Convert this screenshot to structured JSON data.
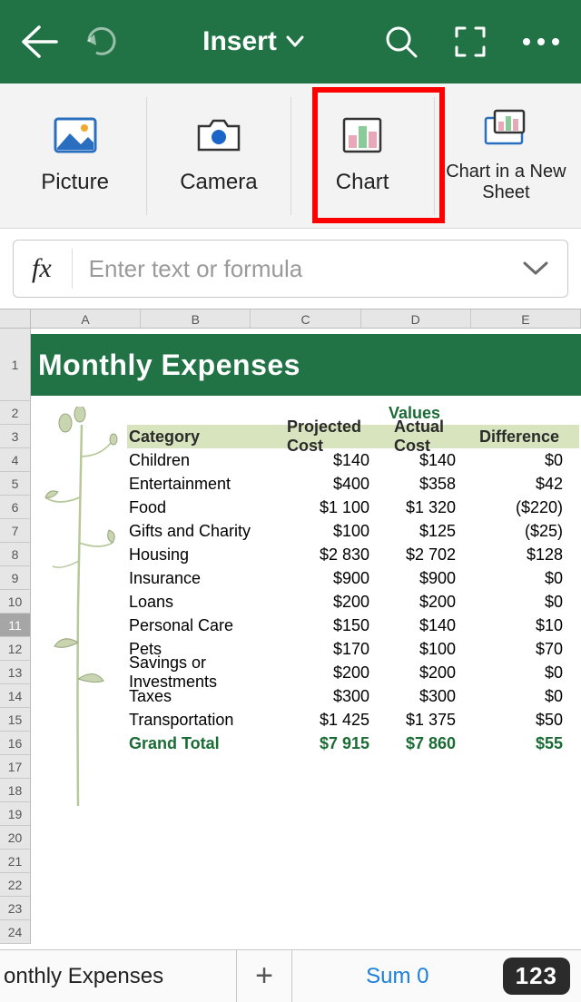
{
  "header": {
    "title": "Insert"
  },
  "ribbon": {
    "items": [
      {
        "label": "Picture"
      },
      {
        "label": "Camera"
      },
      {
        "label": "Chart"
      },
      {
        "label": "Chart in a New Sheet"
      }
    ]
  },
  "formula_bar": {
    "fx": "fx",
    "placeholder": "Enter text or formula"
  },
  "columns": [
    "A",
    "B",
    "C",
    "D",
    "E"
  ],
  "sheet_title": "Monthly Expenses",
  "selected_row_header": 11,
  "table": {
    "values_header": "Values",
    "header": {
      "category": "Category",
      "projected": "Projected Cost",
      "actual": "Actual Cost",
      "difference": "Difference"
    },
    "rows": [
      {
        "category": "Children",
        "projected": "$140",
        "actual": "$140",
        "difference": "$0"
      },
      {
        "category": "Entertainment",
        "projected": "$400",
        "actual": "$358",
        "difference": "$42"
      },
      {
        "category": "Food",
        "projected": "$1 100",
        "actual": "$1 320",
        "difference": "($220)"
      },
      {
        "category": "Gifts and Charity",
        "projected": "$100",
        "actual": "$125",
        "difference": "($25)"
      },
      {
        "category": "Housing",
        "projected": "$2 830",
        "actual": "$2 702",
        "difference": "$128"
      },
      {
        "category": "Insurance",
        "projected": "$900",
        "actual": "$900",
        "difference": "$0"
      },
      {
        "category": "Loans",
        "projected": "$200",
        "actual": "$200",
        "difference": "$0"
      },
      {
        "category": "Personal Care",
        "projected": "$150",
        "actual": "$140",
        "difference": "$10"
      },
      {
        "category": "Pets",
        "projected": "$170",
        "actual": "$100",
        "difference": "$70"
      },
      {
        "category": "Savings or Investments",
        "projected": "$200",
        "actual": "$200",
        "difference": "$0"
      },
      {
        "category": "Taxes",
        "projected": "$300",
        "actual": "$300",
        "difference": "$0"
      },
      {
        "category": "Transportation",
        "projected": "$1 425",
        "actual": "$1 375",
        "difference": "$50"
      }
    ],
    "grand_total": {
      "label": "Grand Total",
      "projected": "$7 915",
      "actual": "$7 860",
      "difference": "$55"
    }
  },
  "bottom": {
    "tab_name": "onthly Expenses",
    "sum": "Sum 0",
    "keyboard": "123"
  }
}
